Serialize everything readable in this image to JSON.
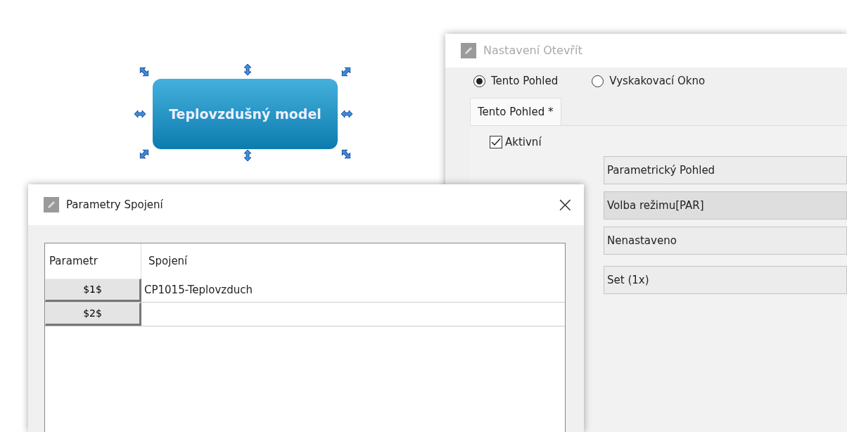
{
  "canvas_node": {
    "label": "Teplovzdušný model",
    "selected": true
  },
  "settings_window": {
    "title": "Nastavení Otevřít",
    "radios": [
      {
        "label": "Tento Pohled",
        "selected": true
      },
      {
        "label": "Vyskakovací Okno",
        "selected": false
      }
    ],
    "tabs": [
      {
        "label": "Tento Pohled *",
        "selected": true
      }
    ],
    "active_checkbox": {
      "label": "Aktivní",
      "checked": true
    },
    "fields": [
      {
        "value": "Parametrický Pohled",
        "highlighted": false
      },
      {
        "value": "Volba režimu[PAR]",
        "highlighted": true
      },
      {
        "value": "Nenastaveno",
        "highlighted": false
      },
      {
        "value": "Set (1x)",
        "highlighted": false
      }
    ]
  },
  "params_window": {
    "title": "Parametry Spojení",
    "close": "×",
    "table": {
      "columns": [
        "Parametr",
        "Spojení"
      ],
      "rows": [
        {
          "parameter": "$1$",
          "connection": "CP1015-Teplovzduch"
        },
        {
          "parameter": "$2$",
          "connection": ""
        }
      ]
    }
  }
}
